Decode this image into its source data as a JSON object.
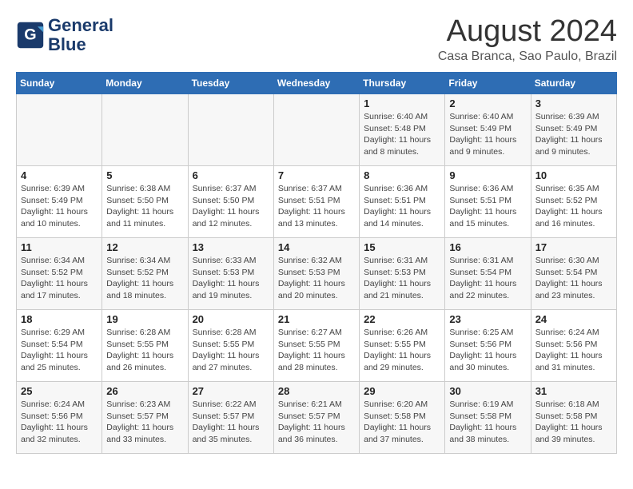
{
  "header": {
    "logo_line1": "General",
    "logo_line2": "Blue",
    "month_year": "August 2024",
    "location": "Casa Branca, Sao Paulo, Brazil"
  },
  "weekdays": [
    "Sunday",
    "Monday",
    "Tuesday",
    "Wednesday",
    "Thursday",
    "Friday",
    "Saturday"
  ],
  "weeks": [
    [
      {
        "day": "",
        "info": ""
      },
      {
        "day": "",
        "info": ""
      },
      {
        "day": "",
        "info": ""
      },
      {
        "day": "",
        "info": ""
      },
      {
        "day": "1",
        "info": "Sunrise: 6:40 AM\nSunset: 5:48 PM\nDaylight: 11 hours\nand 8 minutes."
      },
      {
        "day": "2",
        "info": "Sunrise: 6:40 AM\nSunset: 5:49 PM\nDaylight: 11 hours\nand 9 minutes."
      },
      {
        "day": "3",
        "info": "Sunrise: 6:39 AM\nSunset: 5:49 PM\nDaylight: 11 hours\nand 9 minutes."
      }
    ],
    [
      {
        "day": "4",
        "info": "Sunrise: 6:39 AM\nSunset: 5:49 PM\nDaylight: 11 hours\nand 10 minutes."
      },
      {
        "day": "5",
        "info": "Sunrise: 6:38 AM\nSunset: 5:50 PM\nDaylight: 11 hours\nand 11 minutes."
      },
      {
        "day": "6",
        "info": "Sunrise: 6:37 AM\nSunset: 5:50 PM\nDaylight: 11 hours\nand 12 minutes."
      },
      {
        "day": "7",
        "info": "Sunrise: 6:37 AM\nSunset: 5:51 PM\nDaylight: 11 hours\nand 13 minutes."
      },
      {
        "day": "8",
        "info": "Sunrise: 6:36 AM\nSunset: 5:51 PM\nDaylight: 11 hours\nand 14 minutes."
      },
      {
        "day": "9",
        "info": "Sunrise: 6:36 AM\nSunset: 5:51 PM\nDaylight: 11 hours\nand 15 minutes."
      },
      {
        "day": "10",
        "info": "Sunrise: 6:35 AM\nSunset: 5:52 PM\nDaylight: 11 hours\nand 16 minutes."
      }
    ],
    [
      {
        "day": "11",
        "info": "Sunrise: 6:34 AM\nSunset: 5:52 PM\nDaylight: 11 hours\nand 17 minutes."
      },
      {
        "day": "12",
        "info": "Sunrise: 6:34 AM\nSunset: 5:52 PM\nDaylight: 11 hours\nand 18 minutes."
      },
      {
        "day": "13",
        "info": "Sunrise: 6:33 AM\nSunset: 5:53 PM\nDaylight: 11 hours\nand 19 minutes."
      },
      {
        "day": "14",
        "info": "Sunrise: 6:32 AM\nSunset: 5:53 PM\nDaylight: 11 hours\nand 20 minutes."
      },
      {
        "day": "15",
        "info": "Sunrise: 6:31 AM\nSunset: 5:53 PM\nDaylight: 11 hours\nand 21 minutes."
      },
      {
        "day": "16",
        "info": "Sunrise: 6:31 AM\nSunset: 5:54 PM\nDaylight: 11 hours\nand 22 minutes."
      },
      {
        "day": "17",
        "info": "Sunrise: 6:30 AM\nSunset: 5:54 PM\nDaylight: 11 hours\nand 23 minutes."
      }
    ],
    [
      {
        "day": "18",
        "info": "Sunrise: 6:29 AM\nSunset: 5:54 PM\nDaylight: 11 hours\nand 25 minutes."
      },
      {
        "day": "19",
        "info": "Sunrise: 6:28 AM\nSunset: 5:55 PM\nDaylight: 11 hours\nand 26 minutes."
      },
      {
        "day": "20",
        "info": "Sunrise: 6:28 AM\nSunset: 5:55 PM\nDaylight: 11 hours\nand 27 minutes."
      },
      {
        "day": "21",
        "info": "Sunrise: 6:27 AM\nSunset: 5:55 PM\nDaylight: 11 hours\nand 28 minutes."
      },
      {
        "day": "22",
        "info": "Sunrise: 6:26 AM\nSunset: 5:55 PM\nDaylight: 11 hours\nand 29 minutes."
      },
      {
        "day": "23",
        "info": "Sunrise: 6:25 AM\nSunset: 5:56 PM\nDaylight: 11 hours\nand 30 minutes."
      },
      {
        "day": "24",
        "info": "Sunrise: 6:24 AM\nSunset: 5:56 PM\nDaylight: 11 hours\nand 31 minutes."
      }
    ],
    [
      {
        "day": "25",
        "info": "Sunrise: 6:24 AM\nSunset: 5:56 PM\nDaylight: 11 hours\nand 32 minutes."
      },
      {
        "day": "26",
        "info": "Sunrise: 6:23 AM\nSunset: 5:57 PM\nDaylight: 11 hours\nand 33 minutes."
      },
      {
        "day": "27",
        "info": "Sunrise: 6:22 AM\nSunset: 5:57 PM\nDaylight: 11 hours\nand 35 minutes."
      },
      {
        "day": "28",
        "info": "Sunrise: 6:21 AM\nSunset: 5:57 PM\nDaylight: 11 hours\nand 36 minutes."
      },
      {
        "day": "29",
        "info": "Sunrise: 6:20 AM\nSunset: 5:58 PM\nDaylight: 11 hours\nand 37 minutes."
      },
      {
        "day": "30",
        "info": "Sunrise: 6:19 AM\nSunset: 5:58 PM\nDaylight: 11 hours\nand 38 minutes."
      },
      {
        "day": "31",
        "info": "Sunrise: 6:18 AM\nSunset: 5:58 PM\nDaylight: 11 hours\nand 39 minutes."
      }
    ]
  ]
}
